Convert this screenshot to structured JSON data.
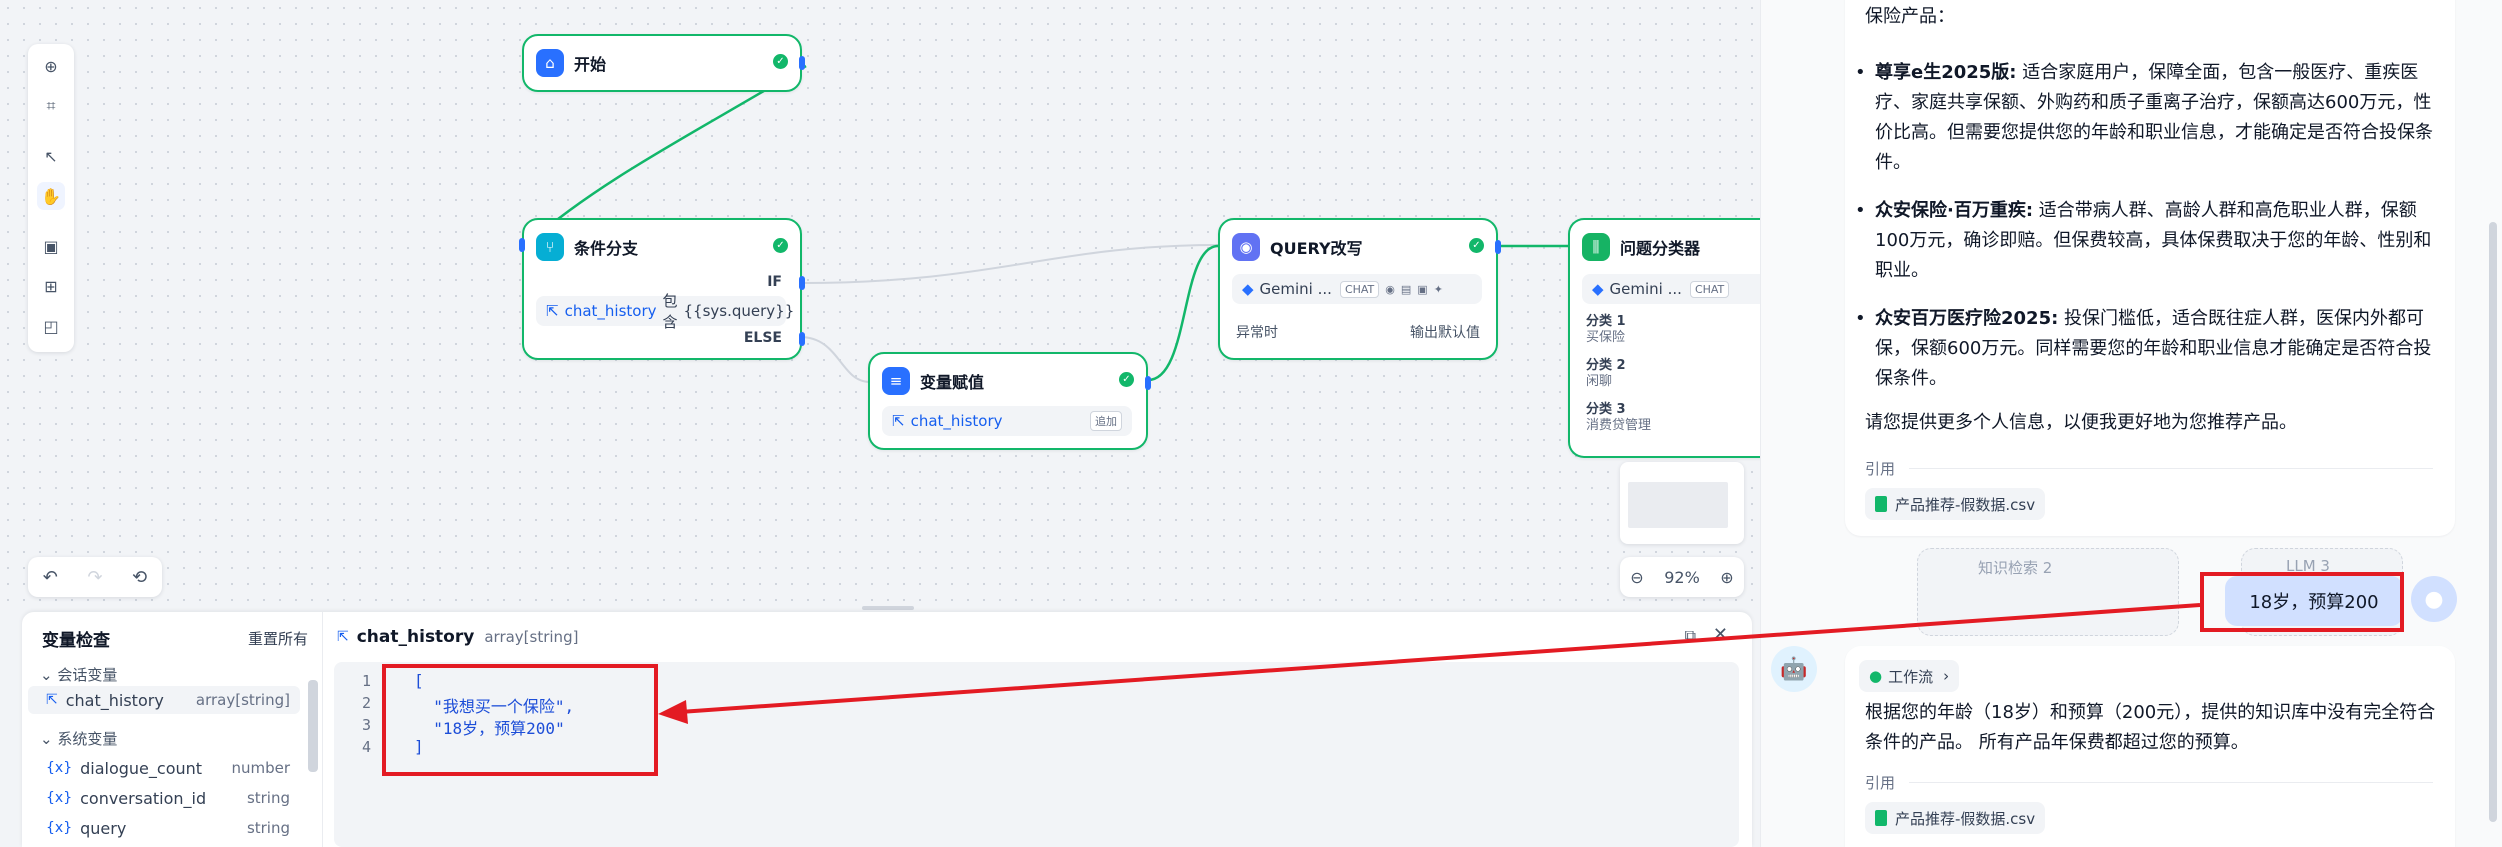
{
  "canvas": {
    "nodes": {
      "start": {
        "title": "开始"
      },
      "condition": {
        "title": "条件分支",
        "if_label": "IF",
        "else_label": "ELSE",
        "condition_var": "chat_history",
        "condition_op": "包含",
        "condition_value": "{{sys.query}}"
      },
      "assign": {
        "title": "变量赋值",
        "var": "chat_history",
        "op": "追加"
      },
      "rewrite": {
        "title": "QUERY改写",
        "model": "Gemini ...",
        "model_tag": "CHAT",
        "on_error_label": "异常时",
        "on_error_value": "输出默认值"
      },
      "classifier": {
        "title": "问题分类器",
        "model": "Gemini ...",
        "model_tag": "CHAT",
        "classes": [
          {
            "label": "分类 1",
            "value": "买保险"
          },
          {
            "label": "分类 2",
            "value": "闲聊"
          },
          {
            "label": "分类 3",
            "value": "消费贷管理"
          }
        ]
      }
    },
    "zoom": "92%"
  },
  "inspector": {
    "title": "变量检查",
    "reset_label": "重置所有",
    "conversation_group": "会话变量",
    "system_group": "系统变量",
    "conversation_vars": [
      {
        "name": "chat_history",
        "type": "array[string]"
      }
    ],
    "system_vars": [
      {
        "name": "dialogue_count",
        "type": "number"
      },
      {
        "name": "conversation_id",
        "type": "string"
      },
      {
        "name": "query",
        "type": "string"
      }
    ],
    "selected": {
      "name": "chat_history",
      "type": "array[string]"
    },
    "code_lines": [
      "[",
      "  \"我想买一个保险\",",
      "  \"18岁，预算200\"",
      "]"
    ],
    "line_numbers": [
      "1",
      "2",
      "3",
      "4"
    ]
  },
  "chat": {
    "intro_partial": "保险产品：",
    "products": [
      {
        "name": "尊享e生2025版:",
        "desc": "适合家庭用户，保障全面，包含一般医疗、重疾医疗、家庭共享保额、外购药和质子重离子治疗，保额高达600万元，性价比高。但需要您提供您的年龄和职业信息，才能确定是否符合投保条件。"
      },
      {
        "name": "众安保险·百万重疾:",
        "desc": "适合带病人群、高龄人群和高危职业人群，保额100万元，确诊即赔。但保费较高，具体保费取决于您的年龄、性别和职业。"
      },
      {
        "name": "众安百万医疗险2025:",
        "desc": "投保门槛低，适合既往症人群，医保内外都可保，保额600万元。同样需要您的年龄和职业信息才能确定是否符合投保条件。"
      }
    ],
    "closing": "请您提供更多个人信息，以便我更好地为您推荐产品。",
    "cite_label": "引用",
    "cite_file": "产品推荐-假数据.csv",
    "ghost_node_1": "知识检索 2",
    "ghost_node_2": "LLM 3",
    "user_message": "18岁，预算200",
    "workflow_label": "工作流",
    "answer": "根据您的年龄（18岁）和预算（200元），提供的知识库中没有完全符合条件的产品。 所有产品年保费都超过您的预算。",
    "cite_label_2": "引用",
    "cite_file_2": "产品推荐-假数据.csv"
  },
  "colors": {
    "accent": "#155eef",
    "success": "#12b76a",
    "annotation_red": "#e31b23"
  }
}
